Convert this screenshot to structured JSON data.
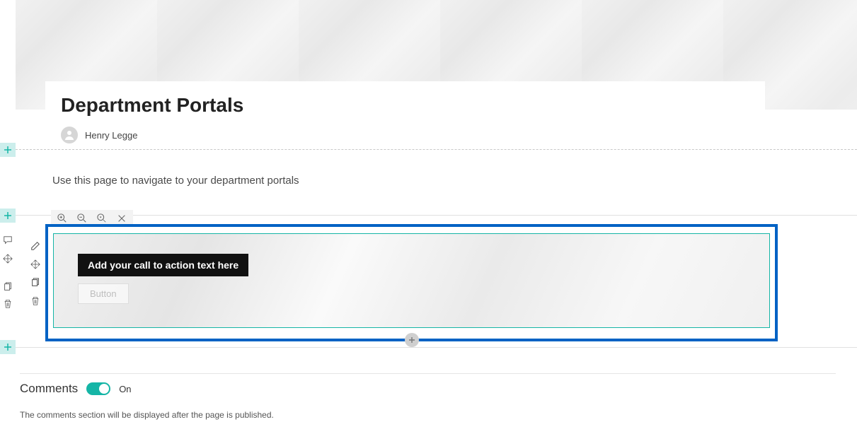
{
  "page": {
    "title": "Department Portals",
    "author": "Henry Legge",
    "intro": "Use this page to navigate to your department portals"
  },
  "cta": {
    "heading": "Add your call to action text here",
    "button_label": "Button"
  },
  "comments": {
    "label": "Comments",
    "state": "On",
    "note": "The comments section will be displayed after the page is published."
  }
}
